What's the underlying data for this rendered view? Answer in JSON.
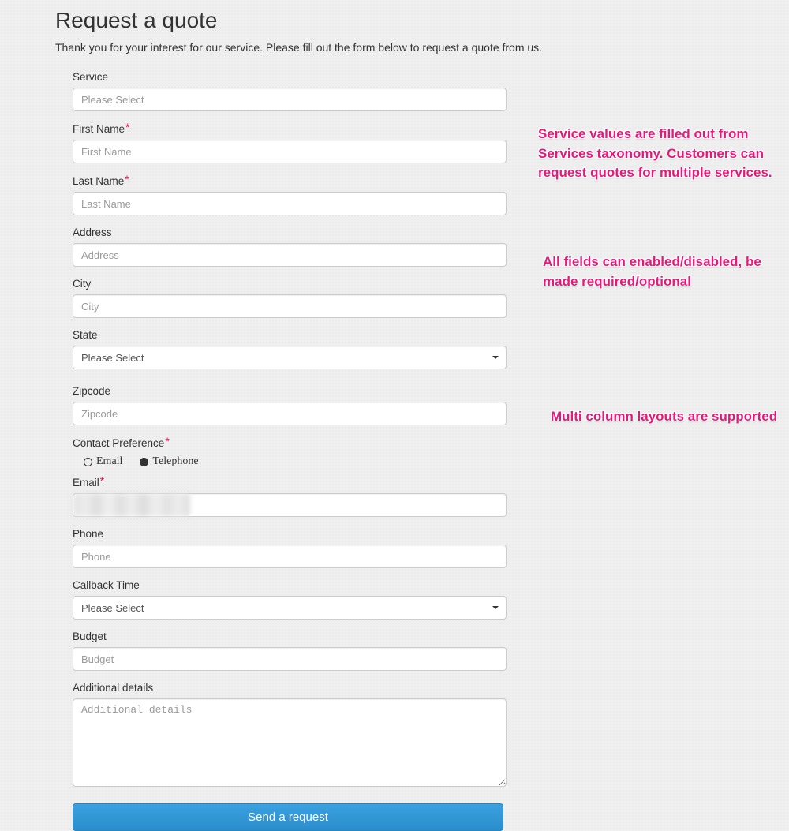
{
  "heading": "Request a quote",
  "subtext": "Thank you for your interest for our service. Please fill out the form below to request a quote from us.",
  "form": {
    "service": {
      "label": "Service",
      "placeholder": "Please Select"
    },
    "first_name": {
      "label": "First Name",
      "placeholder": "First Name",
      "required_marker": "*"
    },
    "last_name": {
      "label": "Last Name",
      "placeholder": "Last Name",
      "required_marker": "*"
    },
    "address": {
      "label": "Address",
      "placeholder": "Address"
    },
    "city": {
      "label": "City",
      "placeholder": "City"
    },
    "state": {
      "label": "State",
      "selected": "Please Select"
    },
    "zipcode": {
      "label": "Zipcode",
      "placeholder": "Zipcode"
    },
    "contact_pref": {
      "label": "Contact Preference",
      "required_marker": "*",
      "options": {
        "email": "Email",
        "telephone": "Telephone"
      }
    },
    "email": {
      "label": "Email",
      "required_marker": "*",
      "value": ""
    },
    "phone": {
      "label": "Phone",
      "placeholder": "Phone"
    },
    "callback_time": {
      "label": "Callback Time",
      "selected": "Please Select"
    },
    "budget": {
      "label": "Budget",
      "placeholder": "Budget"
    },
    "additional": {
      "label": "Additional details",
      "placeholder": "Additional details"
    },
    "submit_label": "Send a request"
  },
  "annotations": {
    "a1": "Service values are filled out from Services taxonomy.  Customers can request quotes for multiple services.",
    "a2": "All fields can enabled/disabled, be made required/optional",
    "a3": "Multi column layouts are supported"
  }
}
